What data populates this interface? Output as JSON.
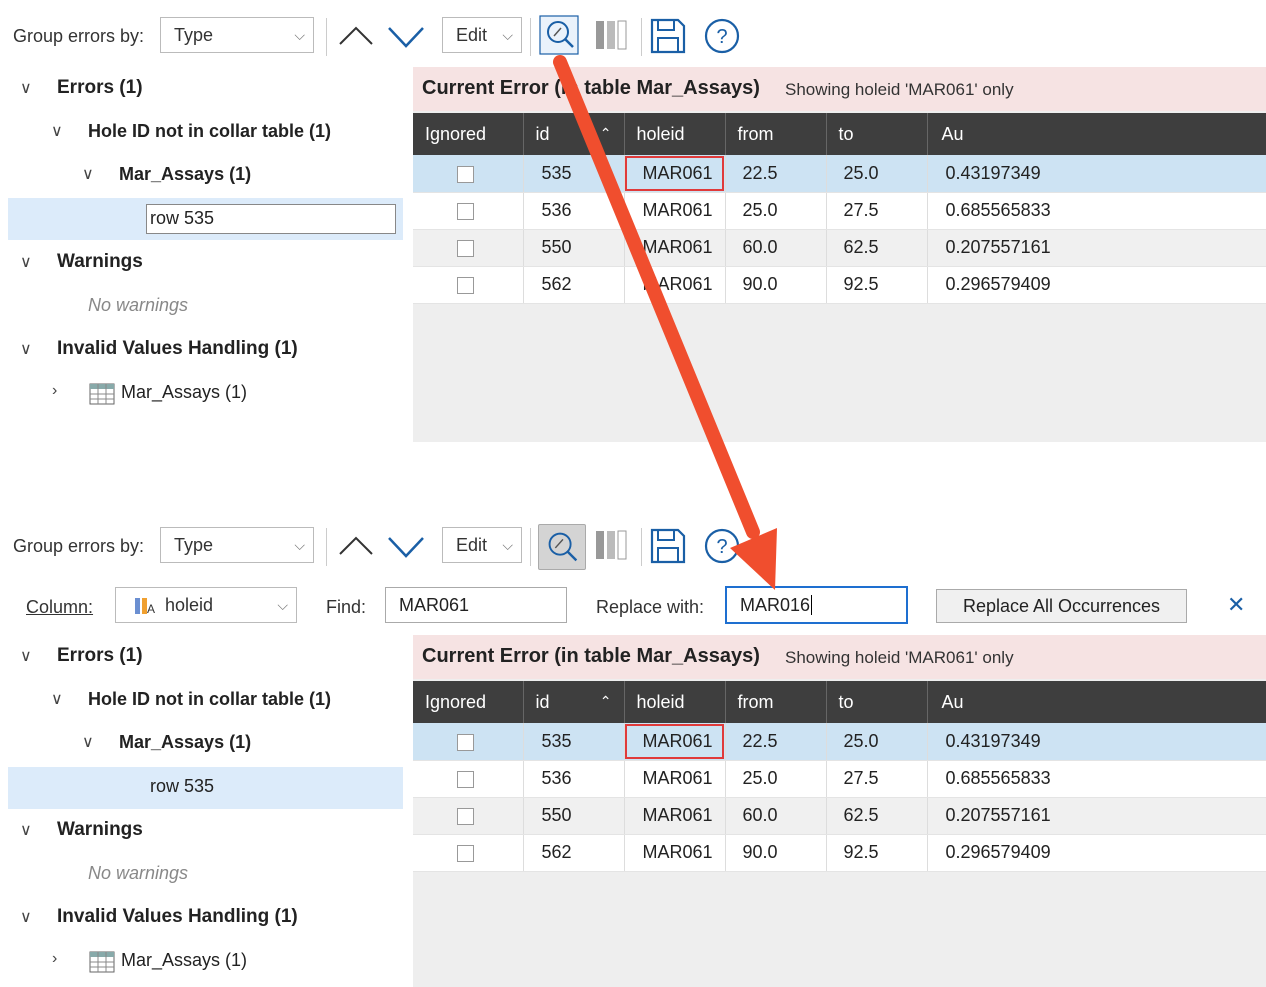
{
  "toolbar": {
    "group_label": "Group errors by:",
    "group_value": "Type",
    "edit_label": "Edit",
    "help_glyph": "?"
  },
  "find_bar": {
    "column_label": "Column:",
    "column_value": "holeid",
    "find_label": "Find:",
    "find_value": "MAR061",
    "replace_label": "Replace with:",
    "replace_value": "MAR016",
    "replace_all_label": "Replace All Occurrences",
    "close_glyph": "✕"
  },
  "tree": {
    "errors": "Errors (1)",
    "hole_id": "Hole ID not in collar table (1)",
    "mar_assays": "Mar_Assays (1)",
    "row": "row 535",
    "warnings": "Warnings",
    "no_warnings": "No warnings",
    "invalid": "Invalid Values Handling (1)",
    "invalid_child": "Mar_Assays (1)"
  },
  "current_error": {
    "title": "Current Error (in table Mar_Assays)",
    "subtitle": "Showing holeid 'MAR061' only"
  },
  "table": {
    "columns": [
      "Ignored",
      "id",
      "holeid",
      "from",
      "to",
      "Au"
    ],
    "rows": [
      [
        "",
        "535",
        "MAR061",
        "22.5",
        "25.0",
        "0.43197349"
      ],
      [
        "",
        "536",
        "MAR061",
        "25.0",
        "27.5",
        "0.685565833"
      ],
      [
        "",
        "550",
        "MAR061",
        "60.0",
        "62.5",
        "0.207557161"
      ],
      [
        "",
        "562",
        "MAR061",
        "90.0",
        "92.5",
        "0.296579409"
      ]
    ]
  },
  "colors": {
    "arrow": "#f04e2e",
    "header_bg": "#3e3e3e",
    "error_bar": "#f6e3e3",
    "selected_row": "#cde3f3"
  },
  "icons": [
    "chevron-up-icon",
    "chevron-down-icon",
    "search-edit-icon",
    "columns-icon",
    "save-icon",
    "help-icon",
    "table-icon",
    "column-icon",
    "close-icon"
  ]
}
